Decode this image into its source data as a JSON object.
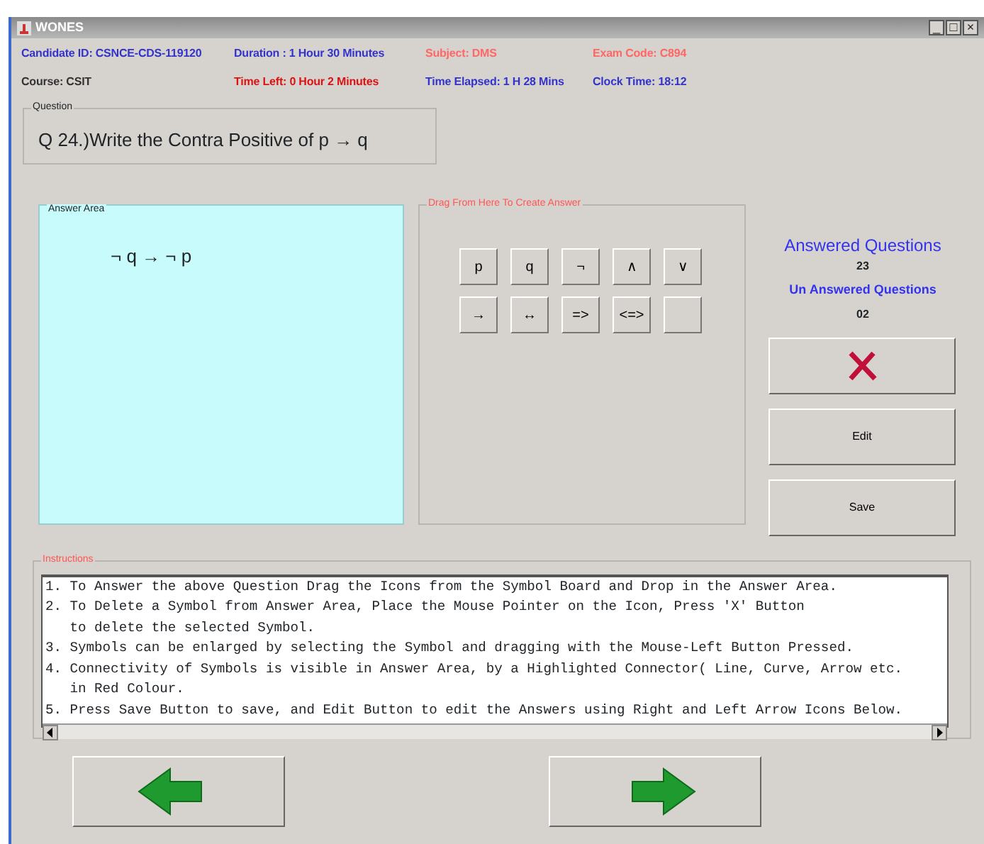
{
  "window": {
    "title": "WONES",
    "controls": [
      "_",
      "□",
      "×"
    ]
  },
  "header": [
    {
      "text": "Candidate ID: CSNCE-CDS-119120",
      "color": "#3333cc"
    },
    {
      "text": "Duration : 1 Hour 30 Minutes",
      "color": "#3333cc"
    },
    {
      "text": "Subject: DMS",
      "color": "#ff6666"
    },
    {
      "text": "Exam Code: C894",
      "color": "#ff6666"
    },
    {
      "text": "Course: CSIT",
      "color": "#333333"
    },
    {
      "text": "Time Left: 0 Hour 2 Minutes",
      "color": "#dd1111"
    },
    {
      "text": "Time Elapsed: 1 H 28 Mins",
      "color": "#3333cc"
    },
    {
      "text": "Clock Time: 18:12",
      "color": "#3333cc"
    }
  ],
  "question": {
    "legend": "Question",
    "text": "Q 24.)Write the Contra Positive of p → q"
  },
  "answer_area": {
    "legend": "Answer Area",
    "answer": "¬ q → ¬ p"
  },
  "symbol_board": {
    "legend": "Drag From Here To Create Answer",
    "symbols": [
      {
        "kind": "symbol",
        "label": "p"
      },
      {
        "kind": "symbol",
        "label": "q"
      },
      {
        "kind": "symbol",
        "label": "¬"
      },
      {
        "kind": "symbol",
        "label": "∧"
      },
      {
        "kind": "symbol",
        "label": "∨"
      },
      {
        "kind": "symbol",
        "label": "→"
      },
      {
        "kind": "symbol",
        "label": "↔"
      },
      {
        "kind": "symbol",
        "label": "=>"
      },
      {
        "kind": "symbol",
        "label": "<=>"
      },
      {
        "kind": "blank"
      }
    ]
  },
  "status": {
    "answered_label": "Answered Questions",
    "answered": "23",
    "unanswered_label": "Un Answered Questions",
    "unanswered": "02"
  },
  "buttons": [
    {
      "kind": "delete"
    },
    {
      "kind": "text",
      "label": "Edit"
    },
    {
      "kind": "text",
      "label": "Save"
    }
  ],
  "instructions": {
    "legend": "Instructions",
    "lines": [
      "1. To Answer the above Question Drag the Icons from the Symbol Board and Drop in the Answer Area.",
      "2. To Delete a Symbol from Answer Area, Place the Mouse Pointer on the Icon, Press 'X' Button",
      "   to delete the selected Symbol.",
      "3. Symbols can be enlarged by selecting the Symbol and dragging with the Mouse-Left Button Pressed.",
      "4. Connectivity of Symbols is visible in Answer Area, by a Highlighted Connector( Line, Curve, Arrow etc.",
      "   in Red Colour.",
      "5. Press Save Button to save, and Edit Button to edit the Answers using Right and Left Arrow Icons Below."
    ]
  },
  "navigation": [
    {
      "kind": "previous"
    },
    {
      "kind": "next"
    }
  ]
}
